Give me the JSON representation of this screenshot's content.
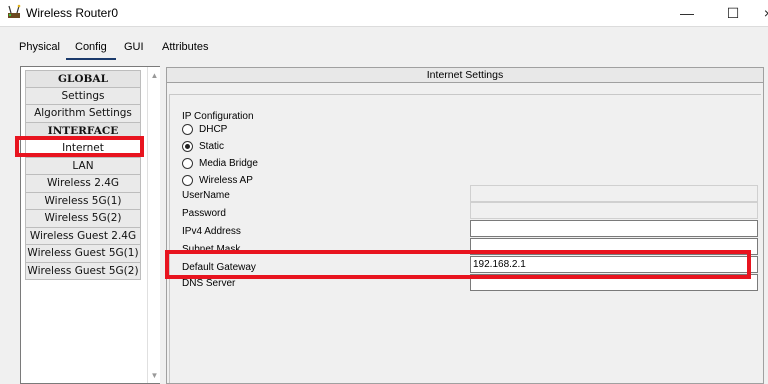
{
  "window": {
    "title": "Wireless Router0",
    "minimize_glyph": "—",
    "maximize_glyph": "☐",
    "close_glyph": "×"
  },
  "tabs": [
    {
      "label": "Physical"
    },
    {
      "label": "Config",
      "active": true
    },
    {
      "label": "GUI"
    },
    {
      "label": "Attributes"
    }
  ],
  "sidebar": {
    "items": [
      {
        "label": "GLOBAL",
        "type": "header"
      },
      {
        "label": "Settings"
      },
      {
        "label": "Algorithm Settings"
      },
      {
        "label": "INTERFACE",
        "type": "header"
      },
      {
        "label": "Internet",
        "selected": true
      },
      {
        "label": "LAN"
      },
      {
        "label": "Wireless 2.4G"
      },
      {
        "label": "Wireless 5G(1)"
      },
      {
        "label": "Wireless 5G(2)"
      },
      {
        "label": "Wireless Guest 2.4G"
      },
      {
        "label": "Wireless Guest 5G(1)"
      },
      {
        "label": "Wireless Guest 5G(2)"
      }
    ]
  },
  "panel": {
    "title": "Internet Settings",
    "ip_configuration": {
      "title": "IP Configuration",
      "options": [
        {
          "label": "DHCP",
          "checked": false
        },
        {
          "label": "Static",
          "checked": true
        },
        {
          "label": "Media Bridge",
          "checked": false
        },
        {
          "label": "Wireless AP",
          "checked": false
        }
      ]
    },
    "fields": [
      {
        "label": "UserName",
        "value": "",
        "disabled": true
      },
      {
        "label": "Password",
        "value": "",
        "disabled": true
      },
      {
        "label": "IPv4 Address",
        "value": "",
        "disabled": false
      },
      {
        "label": "Subnet Mask",
        "value": "",
        "disabled": false
      },
      {
        "label": "Default Gateway",
        "value": "192.168.2.1",
        "disabled": false
      },
      {
        "label": "DNS Server",
        "value": "",
        "disabled": false
      }
    ]
  },
  "colors": {
    "highlight": "#e8141f",
    "active_tab_underline": "#1b3a6b",
    "window_bg": "#f0f0f0"
  }
}
